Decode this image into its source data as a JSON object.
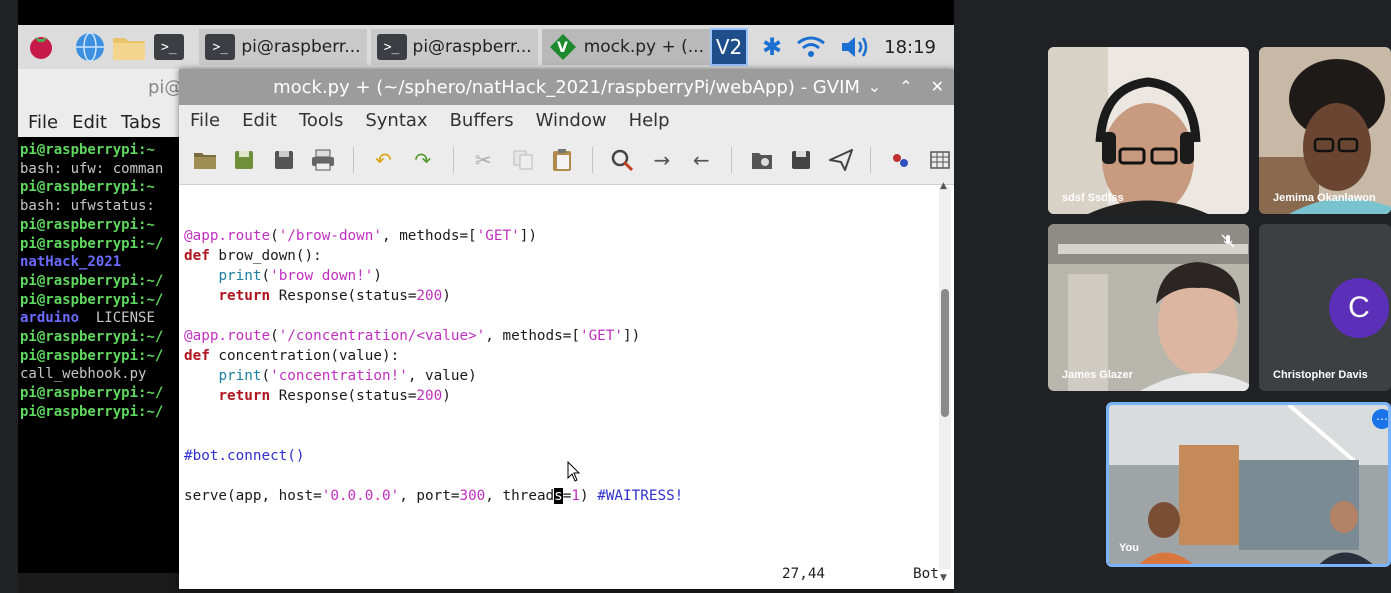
{
  "taskbar": {
    "tasks": [
      {
        "label": "pi@raspberr..."
      },
      {
        "label": "pi@raspberr..."
      },
      {
        "label": "mock.py + (..."
      }
    ],
    "vnc_label": "V2",
    "clock": "18:19"
  },
  "terminal": {
    "title": "pi@",
    "menu": [
      "File",
      "Edit",
      "Tabs"
    ],
    "lines": [
      {
        "text": "pi@raspberrypi:~",
        "style": "green"
      },
      {
        "text": "bash: ufw: comman",
        "style": "gray"
      },
      {
        "text": "pi@raspberrypi:~",
        "style": "green"
      },
      {
        "text": "bash: ufwstatus:",
        "style": "gray"
      },
      {
        "text": "pi@raspberrypi:~",
        "style": "green"
      },
      {
        "text": "pi@raspberrypi:~/",
        "style": "green"
      },
      {
        "text": "natHack_2021",
        "style": "blue"
      },
      {
        "text": "pi@raspberrypi:~/",
        "style": "green"
      },
      {
        "text": "pi@raspberrypi:~/",
        "style": "green"
      },
      {
        "text": "arduino  LICENSE",
        "style": "mix"
      },
      {
        "text": "pi@raspberrypi:~/",
        "style": "green"
      },
      {
        "text": "pi@raspberrypi:~/",
        "style": "green"
      },
      {
        "text": "call_webhook.py",
        "style": "gray"
      },
      {
        "text": "pi@raspberrypi:~/",
        "style": "green"
      },
      {
        "text": "pi@raspberrypi:~/",
        "style": "green"
      }
    ]
  },
  "gvim": {
    "title": "mock.py + (~/sphero/natHack_2021/raspberryPi/webApp) - GVIM",
    "menu": [
      "File",
      "Edit",
      "Tools",
      "Syntax",
      "Buffers",
      "Window",
      "Help"
    ],
    "status_pos": "27,44",
    "status_scroll": "Bot"
  },
  "meeting": {
    "participants": [
      {
        "name": "sdsf Ssdfss"
      },
      {
        "name": "Jemima Okanlawon"
      },
      {
        "name": "James Glazer"
      },
      {
        "name": "Christopher Davis",
        "initial": "C"
      },
      {
        "name": "You"
      }
    ]
  }
}
